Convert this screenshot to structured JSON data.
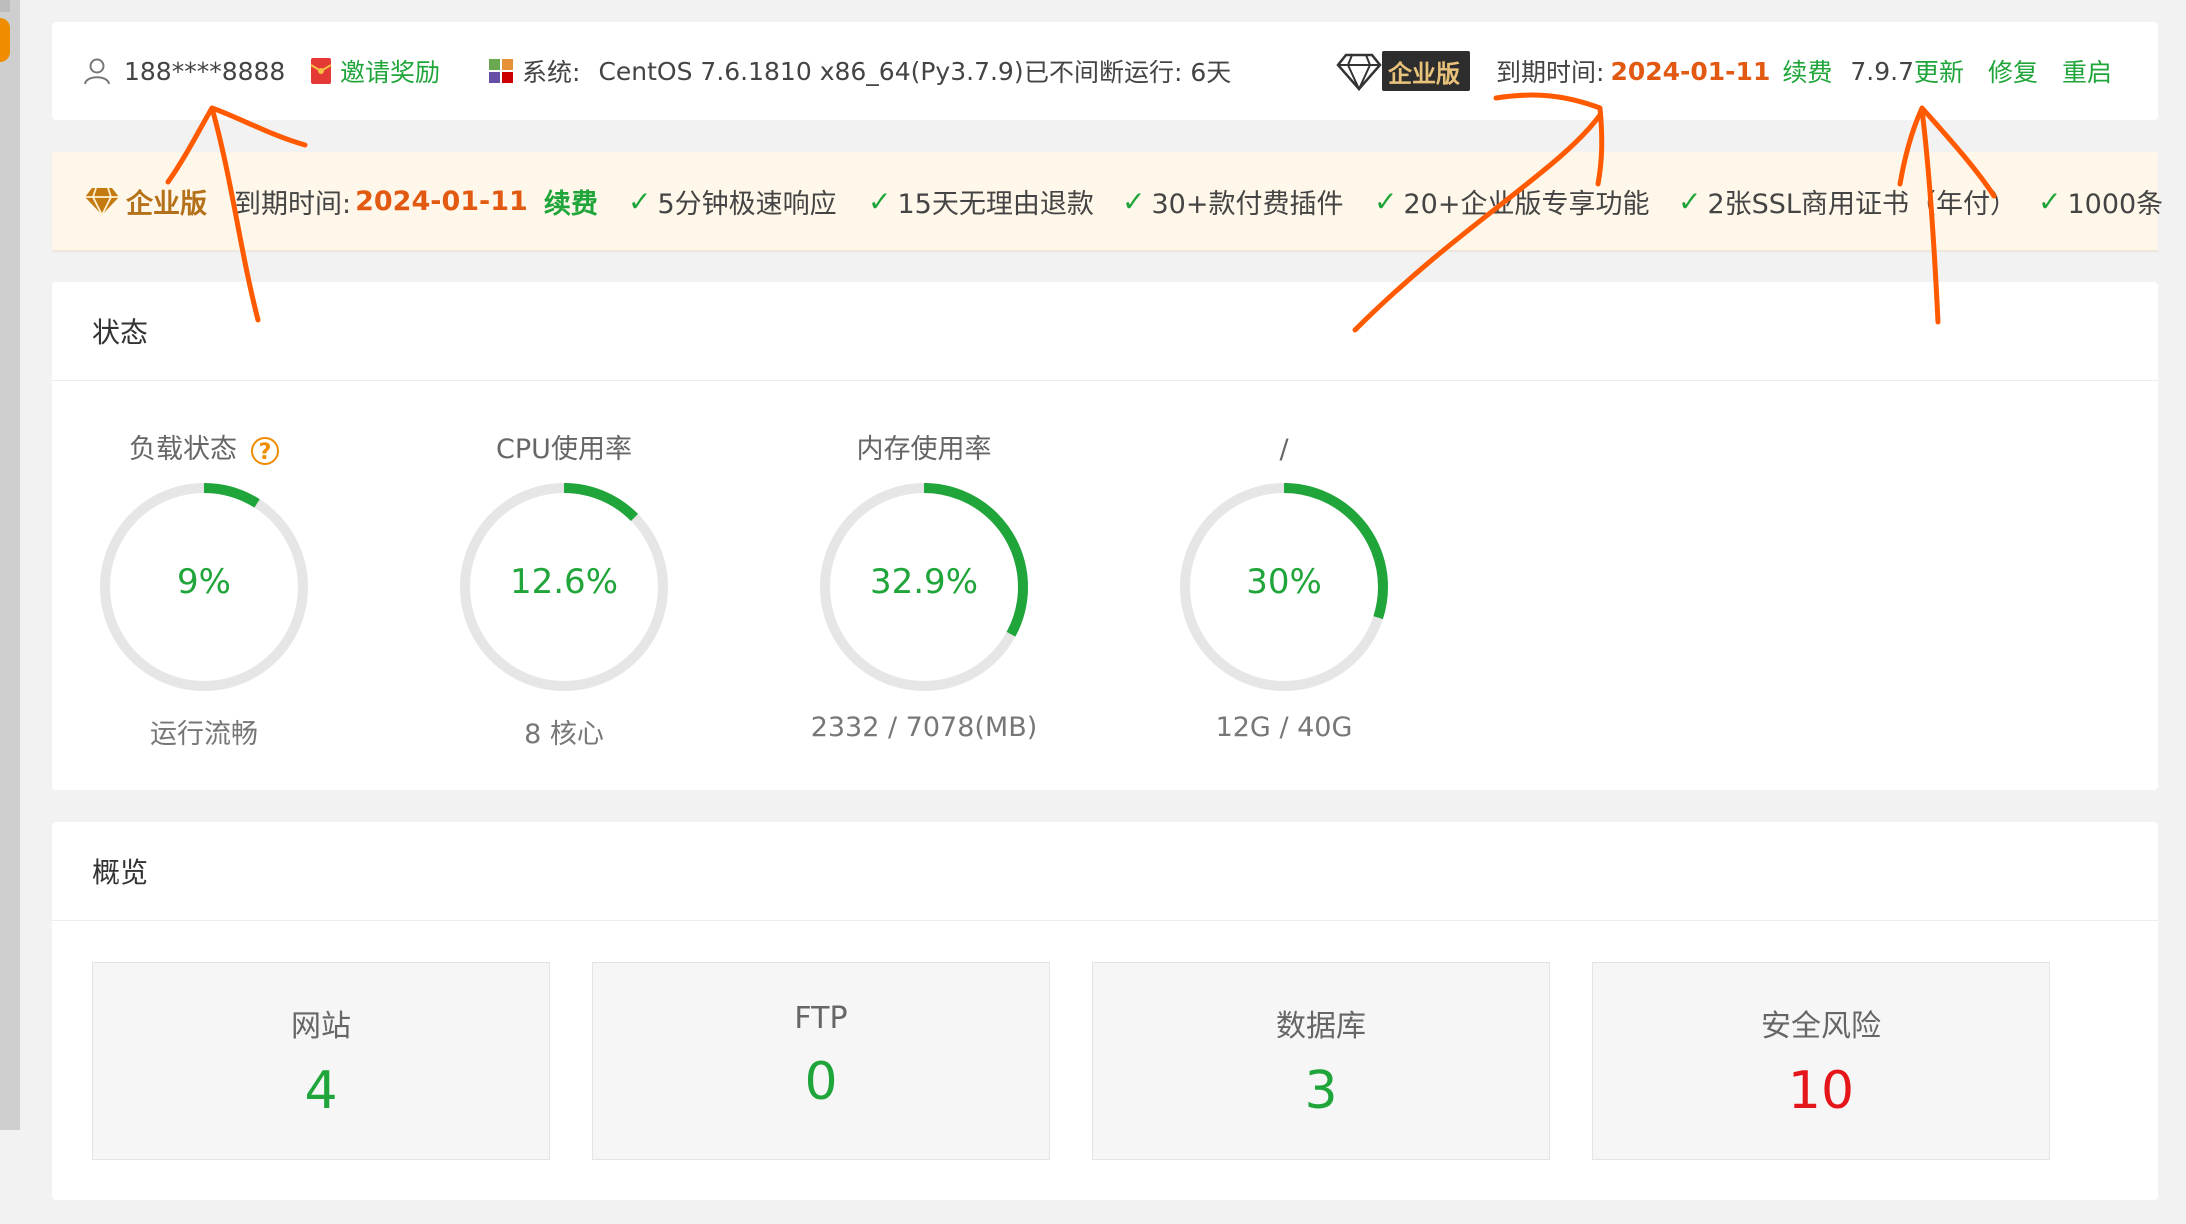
{
  "header": {
    "username": "188****8888",
    "invite_label": "邀请奖励",
    "system_label": "系统:",
    "system_value": "CentOS 7.6.1810 x86_64(Py3.7.9)",
    "uptime": "已不间断运行: 6天",
    "edition_badge": "企业版",
    "expire_label": "到期时间:",
    "expire_date": "2024-01-11",
    "renew_label": "续费",
    "version": "7.9.7",
    "update_label": "更新",
    "repair_label": "修复",
    "restart_label": "重启"
  },
  "promo": {
    "edition": "企业版",
    "expire_label": "到期时间:",
    "expire_date": "2024-01-11",
    "renew_label": "续费",
    "benefits": [
      "5分钟极速响应",
      "15天无理由退款",
      "30+款付费插件",
      "20+企业版专享功能",
      "2张SSL商用证书（年付）",
      "1000条"
    ]
  },
  "status": {
    "title": "状态",
    "gauges": [
      {
        "label": "负载状态",
        "value": "9%",
        "percent": 9,
        "sub": "运行流畅"
      },
      {
        "label": "CPU使用率",
        "value": "12.6%",
        "percent": 12.6,
        "sub": "8 核心"
      },
      {
        "label": "内存使用率",
        "value": "32.9%",
        "percent": 32.9,
        "sub": "2332 / 7078(MB)"
      },
      {
        "label": "/",
        "value": "30%",
        "percent": 30,
        "sub": "12G / 40G"
      }
    ]
  },
  "overview": {
    "title": "概览",
    "cards": [
      {
        "title": "网站",
        "value": "4"
      },
      {
        "title": "FTP",
        "value": "0"
      },
      {
        "title": "数据库",
        "value": "3"
      },
      {
        "title": "安全风险",
        "value": "10"
      }
    ]
  },
  "colors": {
    "accent": "#20a53a",
    "warning": "#e25a12",
    "danger": "#e5161a",
    "annotation": "#ff5a00"
  }
}
